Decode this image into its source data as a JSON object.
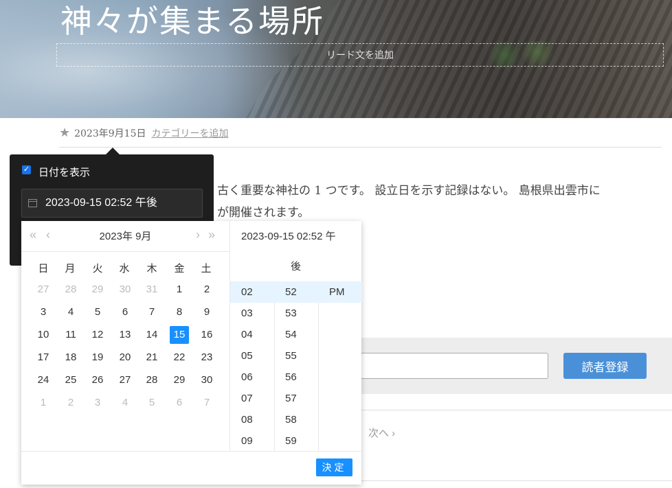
{
  "hero": {
    "title": "神々が集まる場所",
    "lead_placeholder": "リード文を追加"
  },
  "meta": {
    "date": "2023年9月15日",
    "category_link": "カテゴリーを追加"
  },
  "body": {
    "line1": "古く重要な神社の 1 つです。 設立日を示す記録はない。 島根県出雲市に",
    "line2": "が開催されます。"
  },
  "subscribe": {
    "button": "読者登録"
  },
  "pager": {
    "next": "次へ ›"
  },
  "popover": {
    "show_date_label": "日付を表示",
    "datetime_value": "2023-09-15 02:52 午後"
  },
  "picker": {
    "title": "2023年  9月",
    "nav": {
      "prev_year": "«",
      "prev_month": "‹",
      "next_month": "›",
      "next_year": "»"
    },
    "weekdays": [
      "日",
      "月",
      "火",
      "水",
      "木",
      "金",
      "土"
    ],
    "weeks": [
      [
        "27",
        "28",
        "29",
        "30",
        "31",
        "1",
        "2"
      ],
      [
        "3",
        "4",
        "5",
        "6",
        "7",
        "8",
        "9"
      ],
      [
        "10",
        "11",
        "12",
        "13",
        "14",
        "15",
        "16"
      ],
      [
        "17",
        "18",
        "19",
        "20",
        "21",
        "22",
        "23"
      ],
      [
        "24",
        "25",
        "26",
        "27",
        "28",
        "29",
        "30"
      ],
      [
        "1",
        "2",
        "3",
        "4",
        "5",
        "6",
        "7"
      ]
    ],
    "selected_day": "15",
    "time_display_1": "2023-09-15 02:52 午",
    "time_display_2": "後",
    "hours": [
      "02",
      "03",
      "04",
      "05",
      "06",
      "07",
      "08",
      "09"
    ],
    "minutes": [
      "52",
      "53",
      "54",
      "55",
      "56",
      "57",
      "58",
      "59"
    ],
    "meridiem": [
      "PM"
    ],
    "ok_button": "決定"
  },
  "colors": {
    "accent": "#1890ff",
    "subscribe_button": "#4a90d9",
    "popover_bg": "#1e1e1e"
  },
  "icons": {
    "meta": "star-icon",
    "date_input": "calendar-icon"
  }
}
